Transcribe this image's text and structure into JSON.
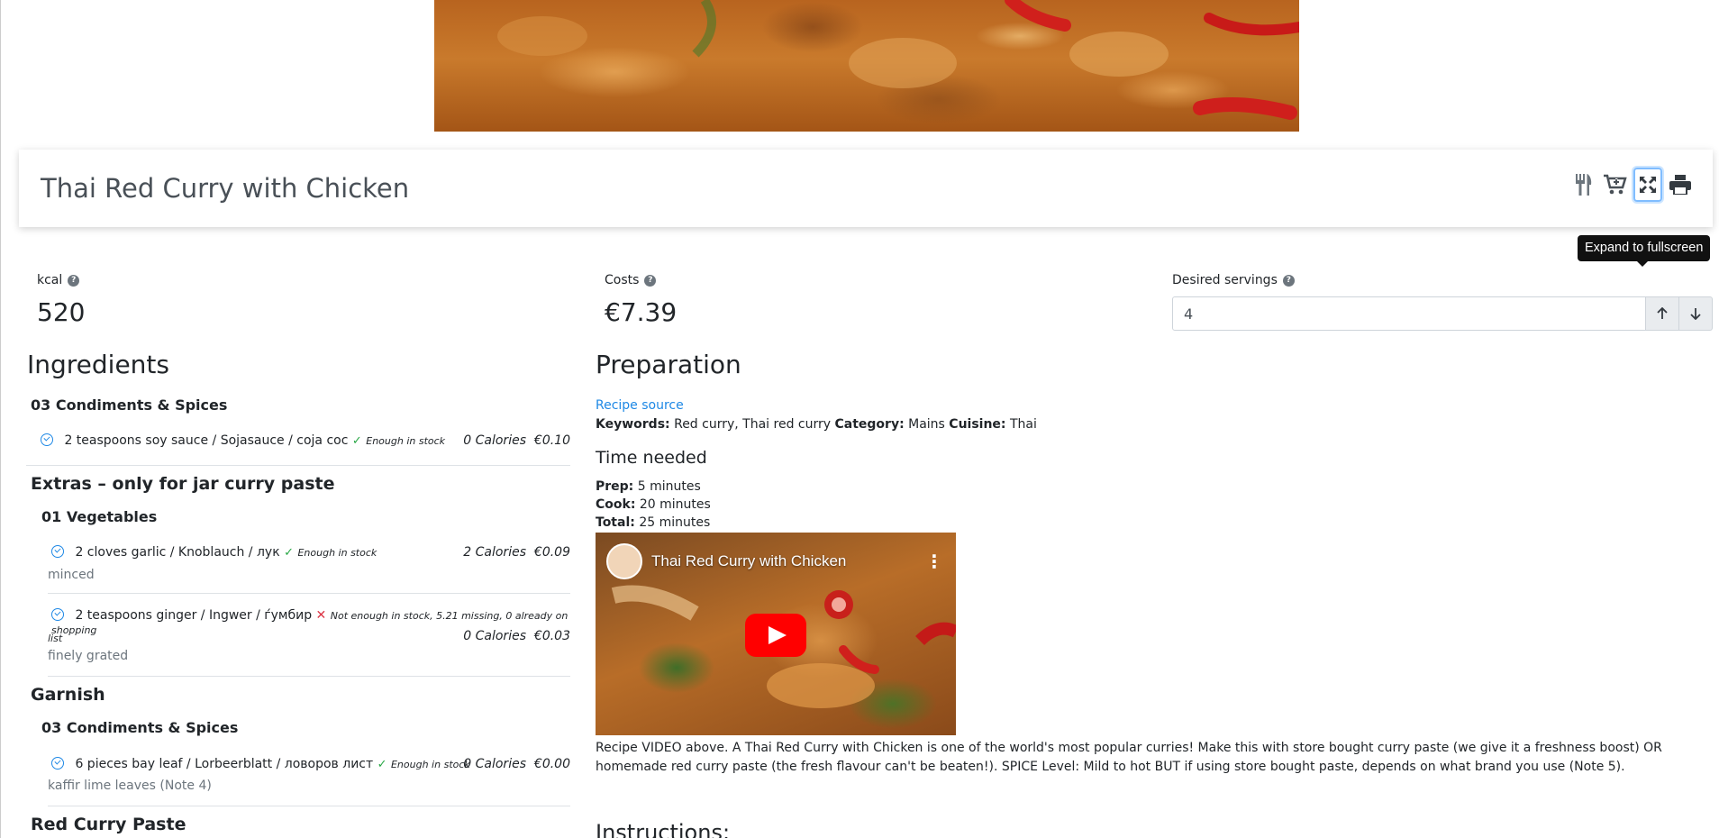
{
  "recipe": {
    "title": "Thai Red Curry with Chicken"
  },
  "tooltip": "Expand to fullscreen",
  "stats": {
    "kcal_label": "kcal",
    "kcal_value": "520",
    "costs_label": "Costs",
    "costs_value": "€7.39",
    "servings_label": "Desired servings",
    "servings_value": "4"
  },
  "ingredients": {
    "heading": "Ingredients",
    "sec1": "03 Condiments & Spices",
    "row1": {
      "text": "2 teaspoons soy sauce / Sojasauce / соја сос",
      "stock": "Enough in stock",
      "cal": "0 Calories",
      "cost": "€0.10"
    },
    "sec2": "Extras – only for jar curry paste",
    "sec2_sub": "01 Vegetables",
    "row2": {
      "text": "2 cloves garlic / Knoblauch / лук",
      "stock": "Enough in stock",
      "cal": "2 Calories",
      "cost": "€0.09",
      "note": "minced"
    },
    "row3": {
      "text": "2 teaspoons ginger / Ingwer / ѓумбир",
      "stock": "Not enough in stock, 5.21 missing, 0 already on shopping",
      "stock2": "list",
      "cal": "0 Calories",
      "cost": "€0.03",
      "note": "finely grated"
    },
    "sec3": "Garnish",
    "sec3_sub": "03 Condiments & Spices",
    "row4": {
      "text": "6 pieces bay leaf / Lorbeerblatt / ловоров лист",
      "stock": "Enough in stock",
      "cal": "0 Calories",
      "cost": "€0.00",
      "note": "kaffir lime leaves (Note 4)"
    },
    "sec4": "Red Curry Paste"
  },
  "preparation": {
    "heading": "Preparation",
    "source_link": "Recipe source",
    "keywords_label": "Keywords:",
    "keywords": "Red curry, Thai red curry",
    "category_label": "Category:",
    "category": "Mains",
    "cuisine_label": "Cuisine:",
    "cuisine": "Thai",
    "time_heading": "Time needed",
    "prep_label": "Prep:",
    "prep": "5 minutes",
    "cook_label": "Cook:",
    "cook": "20 minutes",
    "total_label": "Total:",
    "total": "25 minutes",
    "video_title": "Thai Red Curry with Chicken",
    "description": "Recipe VIDEO above. A Thai Red Curry with Chicken is one of the world's most popular curries! Make this with store bought curry paste (we give it a freshness boost) OR homemade red curry paste (the fresh flavour can't be beaten!). SPICE Level: Mild to hot BUT if using store bought paste, depends on what brand you use (Note 5).",
    "instructions_heading": "Instructions:"
  }
}
